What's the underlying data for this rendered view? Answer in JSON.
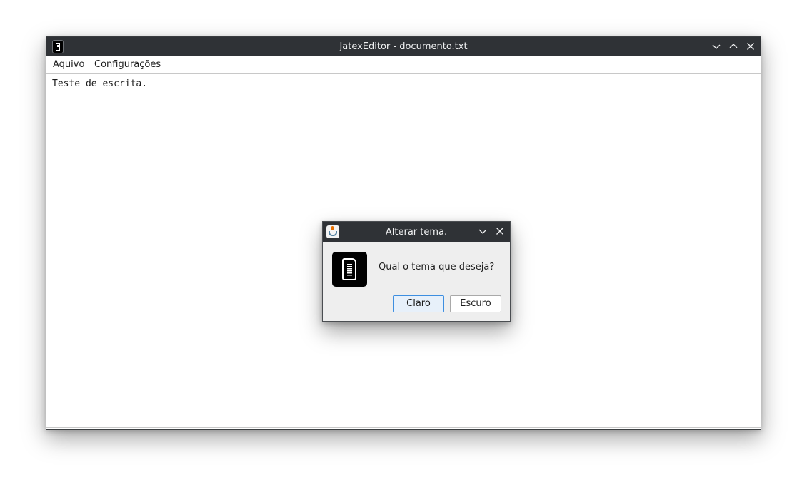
{
  "main_window": {
    "title": "JatexEditor - documento.txt",
    "menu": [
      "Aquivo",
      "Configurações"
    ],
    "editor_text": "Teste de escrita."
  },
  "dialog": {
    "title": "Alterar tema.",
    "message": "Qual o tema que deseja?",
    "buttons": [
      "Claro",
      "Escuro"
    ]
  },
  "icons": {
    "app": "document-icon",
    "dialog_titlebar": "java-icon",
    "dialog_body": "document-icon"
  },
  "colors": {
    "titlebar_bg": "#2f3236",
    "titlebar_text": "#eff0f1",
    "dialog_bg": "#eeeeee",
    "default_button_border": "#3d8ee0"
  }
}
